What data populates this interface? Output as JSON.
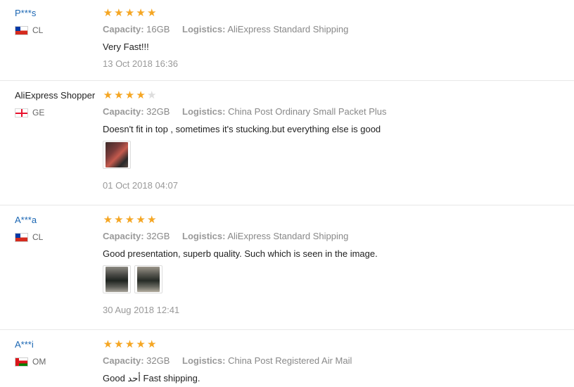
{
  "colors": {
    "star": "#f5a623",
    "star_off": "#dddddd",
    "username_masked": "#1a66b3"
  },
  "labels": {
    "capacity": "Capacity:",
    "logistics": "Logistics:"
  },
  "reviews": [
    {
      "user": "P***s",
      "country": "CL",
      "flag": "chile-flag-icon",
      "rating": 5,
      "capacity": "16GB",
      "logistics": "AliExpress Standard Shipping",
      "text": "Very Fast!!!",
      "date": "13 Oct 2018 16:36",
      "photos": 0
    },
    {
      "user": "AliExpress Shopper",
      "country": "GE",
      "flag": "georgia-flag-icon",
      "rating": 4,
      "capacity": "32GB",
      "logistics": "China Post Ordinary Small Packet Plus",
      "text": "Doesn't fit in top , sometimes it's stucking.but everything else is good",
      "date": "01 Oct 2018 04:07",
      "photos": 1
    },
    {
      "user": "A***a",
      "country": "CL",
      "flag": "chile-flag-icon",
      "rating": 5,
      "capacity": "32GB",
      "logistics": "AliExpress Standard Shipping",
      "text": "Good presentation, superb quality. Such which is seen in the image.",
      "date": "30 Aug 2018 12:41",
      "photos": 2
    },
    {
      "user": "A***i",
      "country": "OM",
      "flag": "oman-flag-icon",
      "rating": 5,
      "capacity": "32GB",
      "logistics": "China Post Registered Air Mail",
      "text": "Good أحد Fast shipping.",
      "date": "",
      "photos": 0
    }
  ]
}
